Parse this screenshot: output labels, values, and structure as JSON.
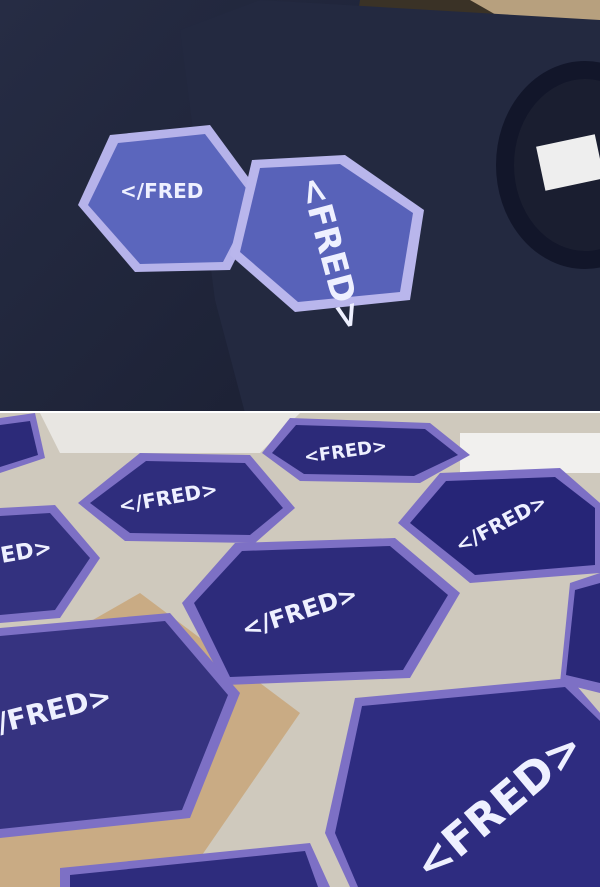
{
  "photos": [
    {
      "subject": "two navy t-shirts printed with hexagon logo"
    },
    {
      "subject": "printed hexagon logo stickers on a table"
    }
  ],
  "logo_texts": {
    "shirt_left": "</FRED",
    "shirt_right": "<FRED>",
    "sticker_1": "<FRED>",
    "sticker_2": "</FRED>",
    "sticker_3": "</FRED>",
    "sticker_4": "ED>",
    "sticker_5": "</FRED>",
    "sticker_6": "/FRED>",
    "sticker_7": "<FRED>"
  },
  "colors": {
    "shirt": "#1f2438",
    "hex_fill": "#5a64b8",
    "hex_border": "#b9b6ec",
    "sticker_fill": "#2c2a78",
    "sticker_border": "#7c6fc4",
    "table": "#cfc9bd"
  }
}
